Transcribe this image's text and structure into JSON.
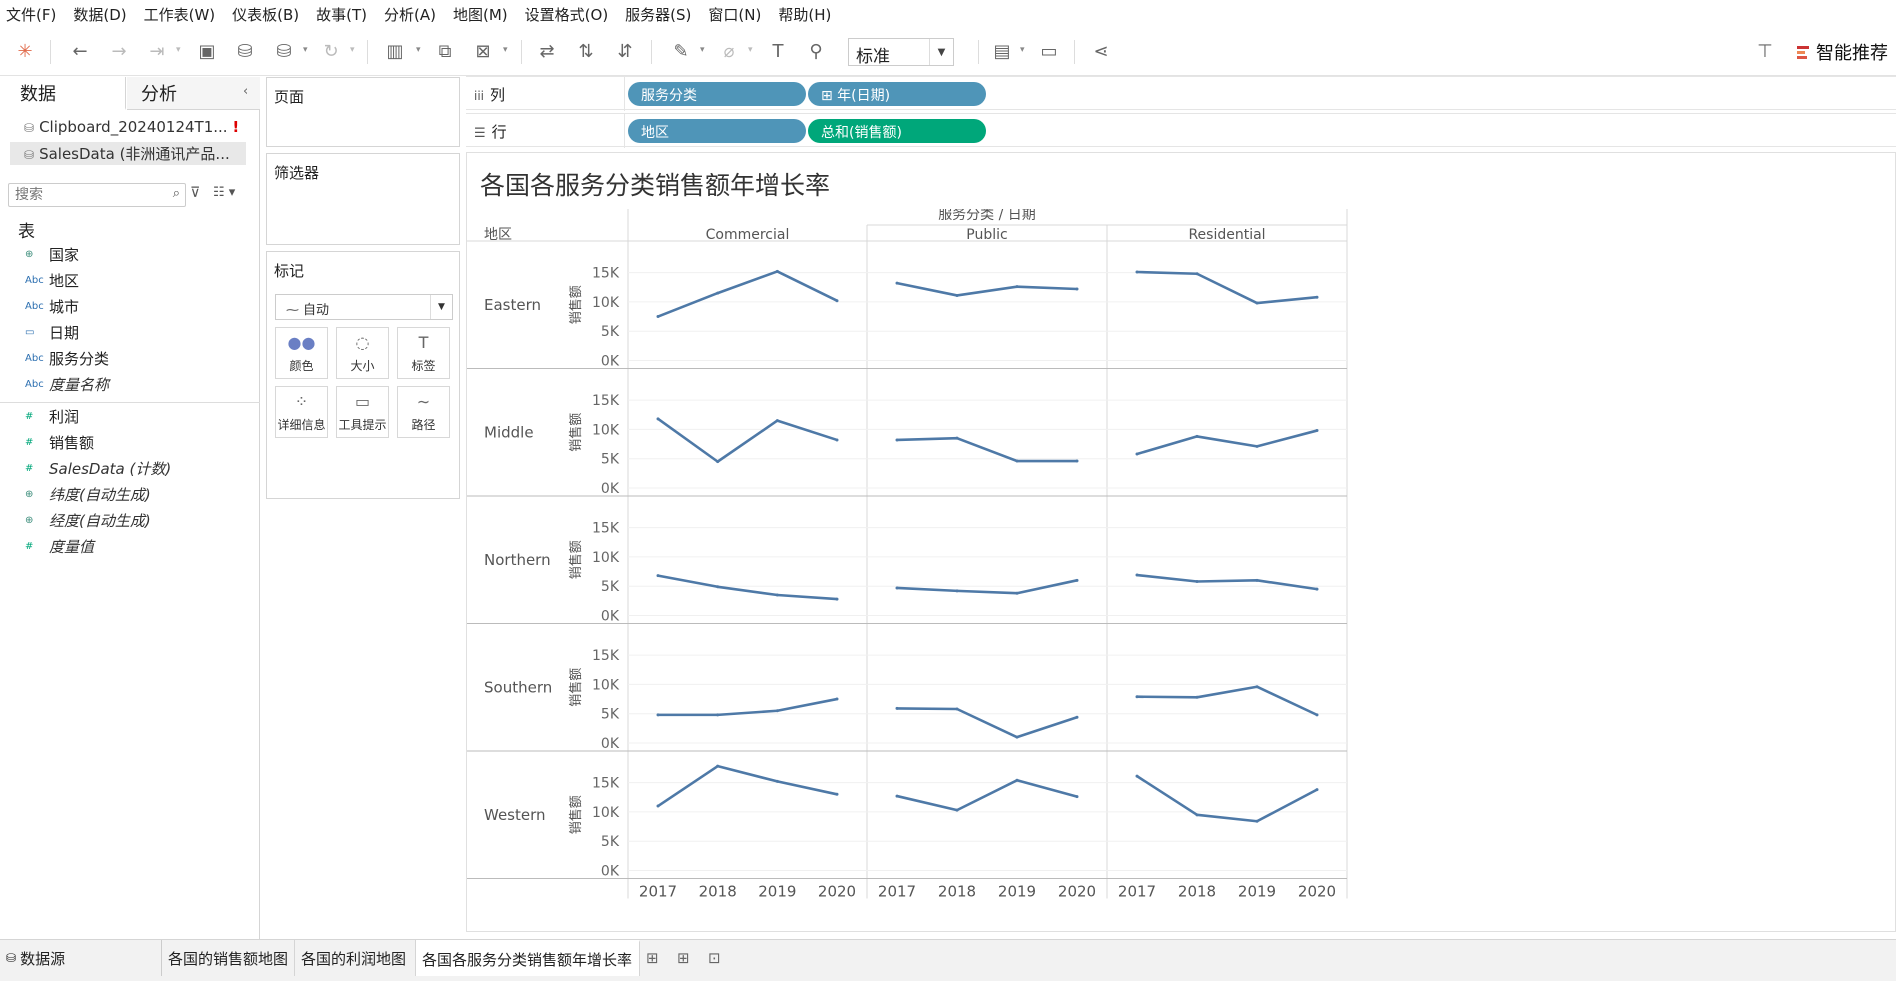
{
  "menu": [
    "文件(F)",
    "数据(D)",
    "工作表(W)",
    "仪表板(B)",
    "故事(T)",
    "分析(A)",
    "地图(M)",
    "设置格式(O)",
    "服务器(S)",
    "窗口(N)",
    "帮助(H)"
  ],
  "toolbar": {
    "fit_value": "标准",
    "smart_label": "智能推荐"
  },
  "left_pane": {
    "tab_data": "数据",
    "tab_analysis": "分析",
    "datasources": [
      {
        "name": "Clipboard_20240124T1...",
        "alert": "!"
      },
      {
        "name": "SalesData (非洲通讯产品..."
      }
    ],
    "search_placeholder": "搜索",
    "tables_heading": "表",
    "dimensions": [
      {
        "icon": "globe",
        "type": "⊕",
        "name": "国家",
        "italic": false
      },
      {
        "icon": "abc",
        "type": "Abc",
        "name": "地区",
        "italic": false
      },
      {
        "icon": "abc",
        "type": "Abc",
        "name": "城市",
        "italic": false
      },
      {
        "icon": "calendar",
        "type": "▭",
        "name": "日期",
        "italic": false
      },
      {
        "icon": "abc",
        "type": "Abc",
        "name": "服务分类",
        "italic": false
      },
      {
        "icon": "abc",
        "type": "Abc",
        "name": "度量名称",
        "italic": true
      }
    ],
    "measures": [
      {
        "icon": "hash",
        "type": "#",
        "name": "利润",
        "italic": false
      },
      {
        "icon": "hash",
        "type": "#",
        "name": "销售额",
        "italic": false
      },
      {
        "icon": "hash",
        "type": "#",
        "name": "SalesData (计数)",
        "italic": true
      },
      {
        "icon": "globe",
        "type": "⊕",
        "name": "纬度(自动生成)",
        "italic": true
      },
      {
        "icon": "globe",
        "type": "⊕",
        "name": "经度(自动生成)",
        "italic": true
      },
      {
        "icon": "hash",
        "type": "#",
        "name": "度量值",
        "italic": true
      }
    ]
  },
  "cards": {
    "pages": "页面",
    "filters": "筛选器",
    "marks": "标记",
    "mark_type": "自动",
    "mark_buttons": [
      "颜色",
      "大小",
      "标签",
      "详细信息",
      "工具提示",
      "路径"
    ]
  },
  "shelves": {
    "columns_label": "列",
    "rows_label": "行",
    "columns_pills": [
      "服务分类",
      "⊞ 年(日期)"
    ],
    "rows_pills": [
      "地区",
      "总和(销售额)"
    ],
    "pill_colors": {
      "dimension": "#4f95b8",
      "measure": "#00a77a"
    }
  },
  "tabs": [
    "数据源",
    "各国的销售额地图",
    "各国的利润地图",
    "各国各服务分类销售额年增长率"
  ],
  "chart_data": {
    "type": "line",
    "title": "各国各服务分类销售额年增长率",
    "header": "服务分类 / 日期",
    "row_header": "地区",
    "ylabel": "销售额",
    "columns": [
      "Commercial",
      "Public",
      "Residential"
    ],
    "rows": [
      "Eastern",
      "Middle",
      "Northern",
      "Southern",
      "Western"
    ],
    "x": [
      "2017",
      "2018",
      "2019",
      "2020"
    ],
    "yticks": [
      "0K",
      "5K",
      "10K",
      "15K"
    ],
    "ylim": [
      0,
      18000
    ],
    "line_color": "#4e79a7",
    "values": {
      "Eastern": {
        "Commercial": [
          7500,
          11500,
          15200,
          10200
        ],
        "Public": [
          13200,
          11100,
          12600,
          12200
        ],
        "Residential": [
          15100,
          14800,
          9800,
          10800
        ]
      },
      "Middle": {
        "Commercial": [
          11800,
          4500,
          11500,
          8200
        ],
        "Public": [
          8200,
          8500,
          4600,
          4600
        ],
        "Residential": [
          5800,
          8800,
          7100,
          9800
        ]
      },
      "Northern": {
        "Commercial": [
          6800,
          4900,
          3500,
          2800
        ],
        "Public": [
          4700,
          4200,
          3800,
          6000
        ],
        "Residential": [
          6900,
          5800,
          6000,
          4500
        ]
      },
      "Southern": {
        "Commercial": [
          4800,
          4800,
          5500,
          7500
        ],
        "Public": [
          5900,
          5800,
          1000,
          4400
        ],
        "Residential": [
          7900,
          7800,
          9600,
          4800
        ]
      },
      "Western": {
        "Commercial": [
          11000,
          17800,
          15200,
          13000
        ],
        "Public": [
          12700,
          10300,
          15400,
          12600
        ],
        "Residential": [
          16100,
          9500,
          8400,
          13800
        ]
      }
    }
  }
}
